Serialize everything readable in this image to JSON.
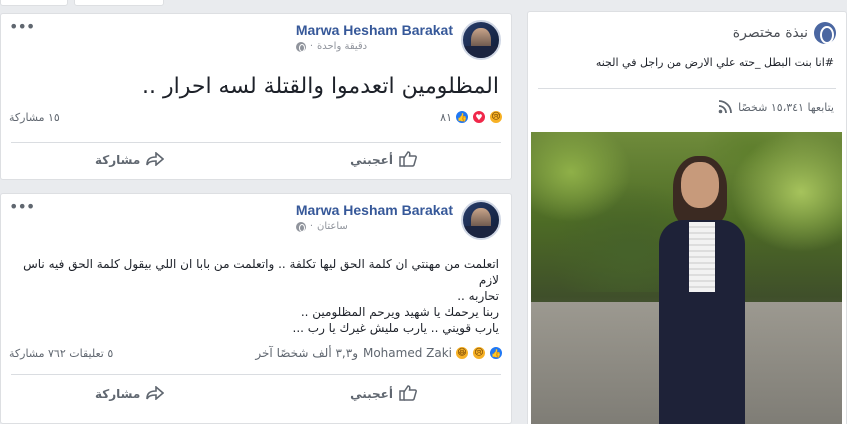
{
  "posts": [
    {
      "author": "Marwa Hesham Barakat",
      "time": "دقيقة واحدة",
      "text": "المظلومين اتعدموا والقتلة لسه احرار ..",
      "reaction_count": "٨١",
      "shares": "١٥ مشاركة",
      "like_label": "أعجبني",
      "share_label": "مشاركة"
    },
    {
      "author": "Marwa Hesham Barakat",
      "time": "ساعتان",
      "lines": [
        "اتعلمت من مهنتي ان كلمة الحق ليها تكلفة .. واتعلمت من بابا ان اللي بيقول كلمة الحق فيه ناس لازم",
        "تحاربه ..",
        "ربنا يرحمك يا شهيد ويرحم المظلومين ..",
        "يارب قويني .. يارب مليش غيرك يا رب ..."
      ],
      "reactor_name": "Mohamed Zaki",
      "reactor_others": "و٣,٣ ألف شخصًا آخر",
      "comments_shares": "٥ تعليقات ٧٦٢ مشاركة",
      "like_label": "أعجبني",
      "share_label": "مشاركة"
    }
  ],
  "sidebar": {
    "title": "نبذة مختصرة",
    "bio": "#انا بنت البطل _حته علي الارض من راجل في الجنه",
    "followers": "يتابعها ١٥،٣٤١ شخصًا"
  },
  "colors": {
    "link": "#365899",
    "like_blue": "#2078f4",
    "love_red": "#f0284a",
    "reaction_yellow": "#f7b125"
  },
  "icons": [
    "globe-icon",
    "rss-icon",
    "like-thumb-icon",
    "share-arrow-icon",
    "more-options-icon"
  ]
}
